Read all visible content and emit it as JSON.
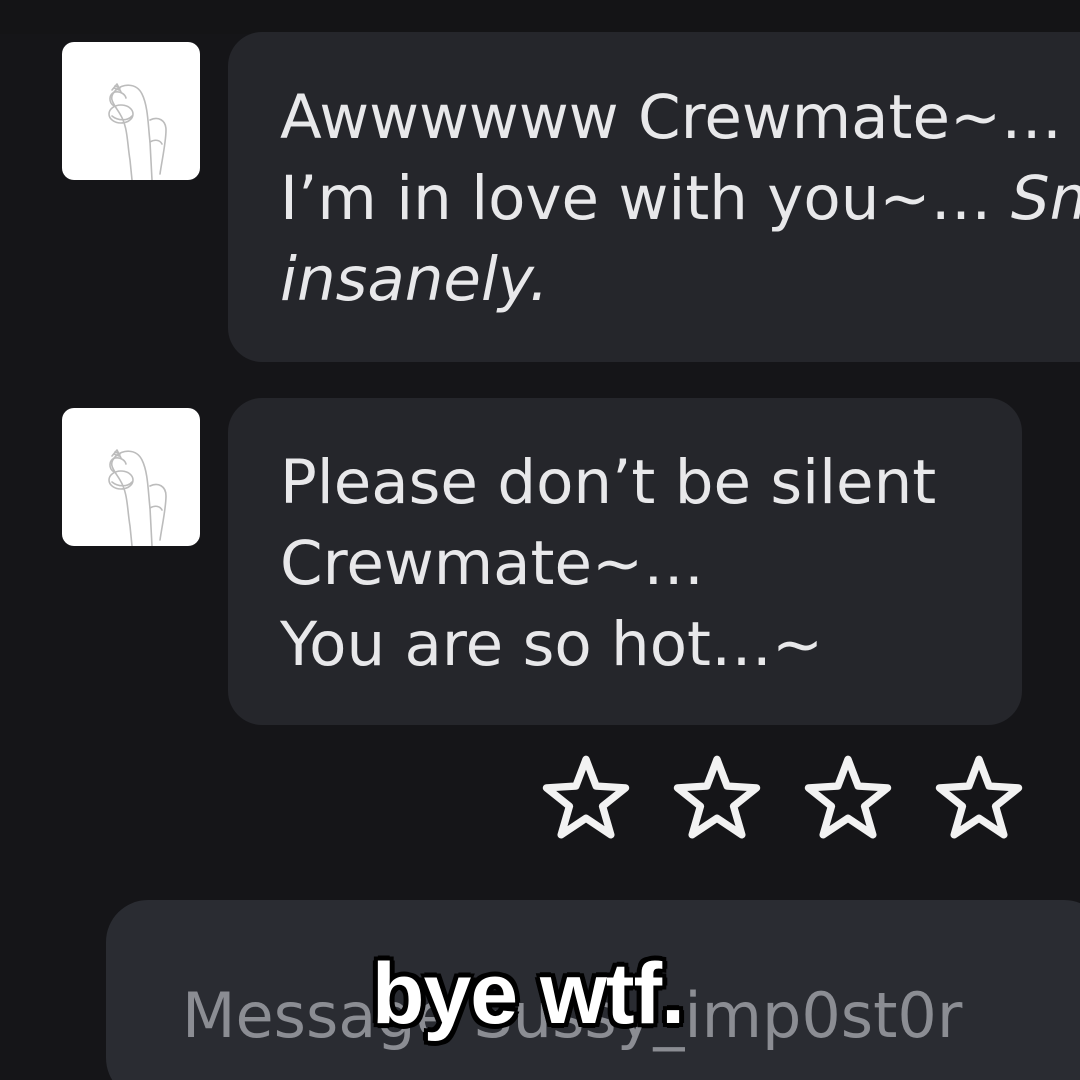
{
  "messages": [
    {
      "avatar_icon": "crewmate-sketch-avatar-icon",
      "lines": [
        {
          "text": "Awwwwww Crewmate~…"
        },
        {
          "text": "I’m in love with you~… ",
          "italic_tail": "Sm"
        },
        {
          "italic_text": "insanely."
        }
      ]
    },
    {
      "avatar_icon": "crewmate-sketch-avatar-icon",
      "lines": [
        {
          "text": "Please don’t be silent"
        },
        {
          "text": "Crewmate~…"
        },
        {
          "text": "You are so hot…~"
        }
      ]
    }
  ],
  "rating": {
    "icon": "star-outline-icon",
    "count": 4,
    "filled": 0,
    "color": "#f2f2f2"
  },
  "composer": {
    "placeholder": "Message Sussy_imp0st0r"
  },
  "caption": {
    "text": "bye wtf."
  },
  "colors": {
    "background": "#151518",
    "bubble": "#25262b",
    "composer": "#2a2c32",
    "text": "#e8e8ea",
    "placeholder": "#8b8d93"
  }
}
